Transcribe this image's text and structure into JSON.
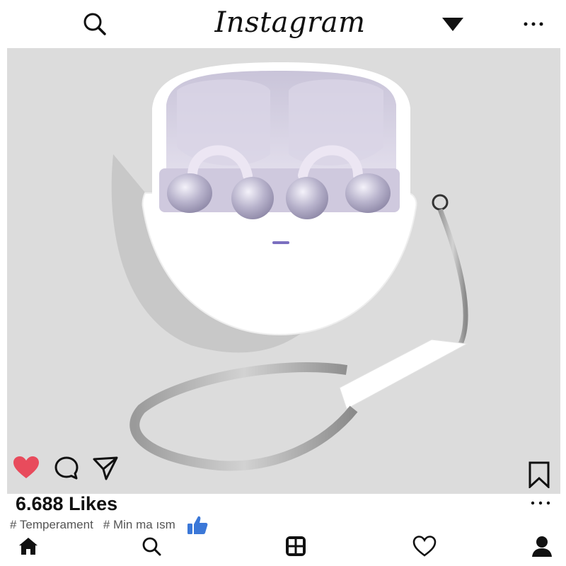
{
  "app": {
    "brand": "Instagram"
  },
  "header": {
    "icons": [
      "search-icon",
      "dropdown-triangle-icon",
      "more-icon"
    ]
  },
  "post": {
    "likes_text": "6.688 Likes",
    "liked": true,
    "hashtags": [
      "# Temperament",
      "# Min ma ısm"
    ],
    "actions": [
      "heart-icon",
      "comment-icon",
      "share-icon",
      "bookmark-icon"
    ],
    "colors": {
      "heart": "#e84b5c",
      "thumb": "#3b78d8",
      "photo_bg": "#dcdcdc"
    }
  },
  "bottom_nav": {
    "items": [
      "home-icon",
      "search-icon",
      "add-post-icon",
      "activity-heart-icon",
      "profile-icon"
    ]
  }
}
